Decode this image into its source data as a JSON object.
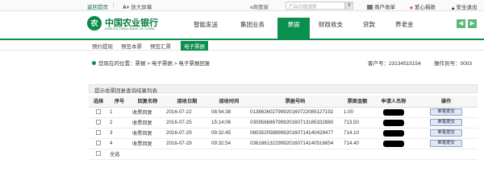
{
  "topbar": {
    "home_label": "返回首页",
    "zoom_label": "放大屏幕",
    "zoom_icon": "A+",
    "emanager_label": "e商管家",
    "search_placeholder": "产品/功能搜索",
    "search_icon": "magnifier-icon",
    "merchant_label": "商户收单",
    "charity_label": "爱心捐款",
    "logout_label": "安全退出"
  },
  "header": {
    "bank_name_cn": "中国农业银行",
    "bank_name_en": "AGRICULTURAL BANK OF CHINA",
    "nav": [
      "智能发送",
      "集团业务",
      "票据",
      "财政收支",
      "贷款",
      "养老金"
    ],
    "active_nav": "票据",
    "prev_icon": "chevron-left-icon",
    "next_icon": "chevron-right-icon",
    "brand_color": "#0a8f4e"
  },
  "subnav": {
    "items": [
      "预约提现",
      "预签本票",
      "预签汇票",
      "电子票据"
    ],
    "active": "电子票据"
  },
  "breadcrumb": {
    "text": "您现在的位置：票据 > 电子票据 > 电子票据回复",
    "account_label": "客户号：23134515154",
    "operator_label": "操作员号：0003"
  },
  "panel": {
    "title": "提示收票回复查询结果列表",
    "columns": [
      "选择",
      "序号",
      "回复名称",
      "接收日期",
      "接收时间",
      "票据号码",
      "票面金额",
      "申请人名称",
      "操作"
    ],
    "rows": [
      {
        "seq": "1",
        "name": "收票回复",
        "date": "2016-07-22",
        "time": "08:54:38",
        "number": "013862602799920160722085127192",
        "amount": "1.00",
        "action": "单笔提交"
      },
      {
        "seq": "2",
        "name": "收票回复",
        "date": "2016-07-25",
        "time": "15:14:06",
        "number": "030956686799920160713165332880",
        "amount": "713.50",
        "action": "单笔提交"
      },
      {
        "seq": "3",
        "name": "收票回复",
        "date": "2016-07-29",
        "time": "09:32:45",
        "number": "080352058899920160714140428477",
        "amount": "714.10",
        "action": "单笔提交"
      },
      {
        "seq": "4",
        "name": "收票回复",
        "date": "2016-07-29",
        "time": "09:32:54",
        "number": "036186132299920160714140516654",
        "amount": "714.40",
        "action": "单笔提交"
      }
    ],
    "select_all_label": "全选"
  }
}
